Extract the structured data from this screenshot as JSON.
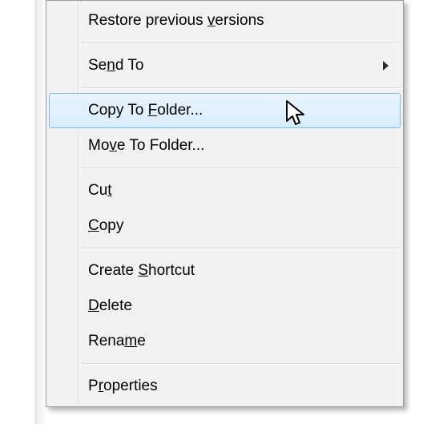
{
  "menu": {
    "restore": {
      "pre": "Restore previous ",
      "u": "v",
      "post": "ersions"
    },
    "sendto": {
      "pre": "Se",
      "u": "n",
      "post": "d To"
    },
    "copyto": {
      "pre": "Copy To ",
      "u": "F",
      "post": "older..."
    },
    "moveto": {
      "pre": "Mo",
      "u": "v",
      "post": "e To Folder..."
    },
    "cut": {
      "pre": "Cu",
      "u": "t",
      "post": ""
    },
    "copy": {
      "pre": "",
      "u": "C",
      "post": "opy"
    },
    "shortcut": {
      "pre": "Create ",
      "u": "S",
      "post": "hortcut"
    },
    "delete": {
      "pre": "",
      "u": "D",
      "post": "elete"
    },
    "rename": {
      "pre": "Rena",
      "u": "m",
      "post": "e"
    },
    "props": {
      "pre": "P",
      "u": "r",
      "post": "operties"
    }
  }
}
